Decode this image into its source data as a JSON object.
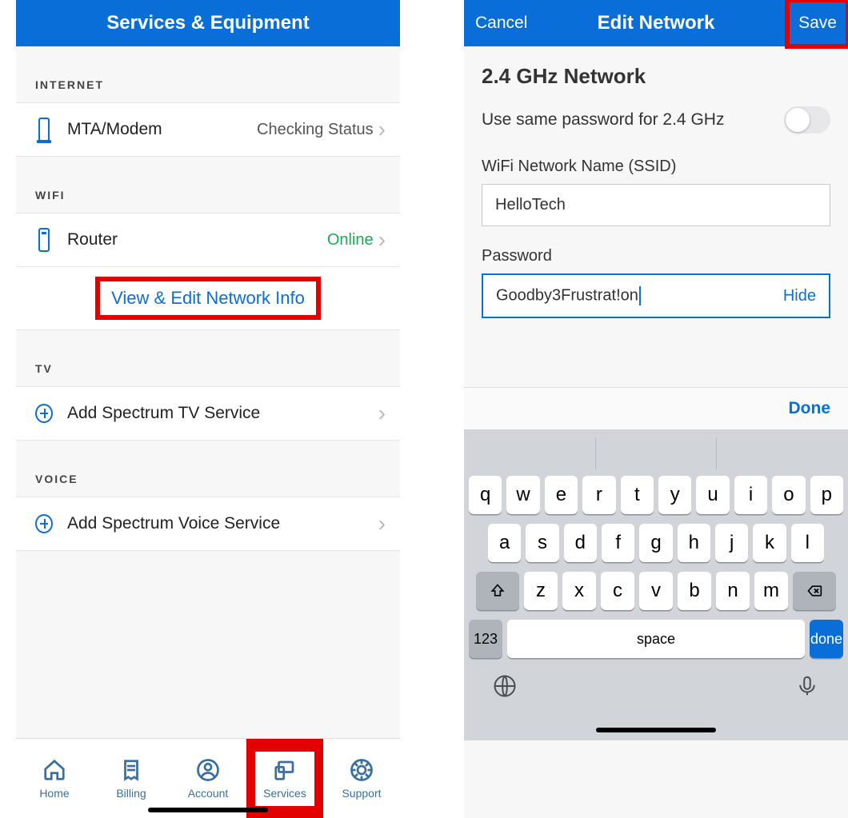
{
  "left": {
    "title": "Services & Equipment",
    "sections": {
      "internet": {
        "header": "INTERNET",
        "item": {
          "label": "MTA/Modem",
          "status": "Checking Status"
        }
      },
      "wifi": {
        "header": "WIFI",
        "item": {
          "label": "Router",
          "status": "Online"
        },
        "link": "View & Edit Network Info"
      },
      "tv": {
        "header": "TV",
        "item": {
          "label": "Add Spectrum TV Service"
        }
      },
      "voice": {
        "header": "VOICE",
        "item": {
          "label": "Add Spectrum Voice Service"
        }
      }
    },
    "tabs": {
      "home": "Home",
      "billing": "Billing",
      "account": "Account",
      "services": "Services",
      "support": "Support"
    }
  },
  "right": {
    "cancel": "Cancel",
    "title": "Edit Network",
    "save": "Save",
    "section_title": "2.4 GHz Network",
    "toggle_label": "Use same password for 2.4 GHz",
    "ssid_label": "WiFi Network Name (SSID)",
    "ssid_value": "HelloTech",
    "pwd_label": "Password",
    "pwd_value": "Goodby3Frustrat!on",
    "hide": "Hide",
    "done_acc": "Done",
    "keyboard": {
      "row1": [
        "q",
        "w",
        "e",
        "r",
        "t",
        "y",
        "u",
        "i",
        "o",
        "p"
      ],
      "row2": [
        "a",
        "s",
        "d",
        "f",
        "g",
        "h",
        "j",
        "k",
        "l"
      ],
      "row3": [
        "z",
        "x",
        "c",
        "v",
        "b",
        "n",
        "m"
      ],
      "num": "123",
      "space": "space",
      "done": "done"
    }
  }
}
